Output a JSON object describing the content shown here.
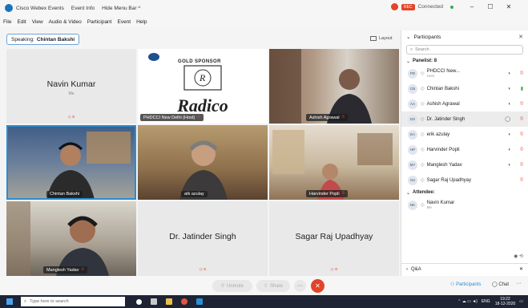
{
  "titlebar": {
    "app_title": "Cisco Webex Events",
    "event_info": "Event Info",
    "hide_menu": "Hide Menu Bar ^",
    "rec_badge": "REC",
    "status": "Connected",
    "minimize": "–",
    "maximize": "☐",
    "close": "✕"
  },
  "menu": [
    "File",
    "Edit",
    "View",
    "Audio & Video",
    "Participant",
    "Event",
    "Help"
  ],
  "speaking": {
    "label": "Speaking:",
    "name": "Chintan Bakshi"
  },
  "layout_label": "Layout",
  "tiles": [
    {
      "name": "Navin Kumar",
      "sub": "Me"
    },
    {
      "label": "PHDCCI New Delhi (Host)",
      "sponsor": "GOLD SPONSOR",
      "brand": "Radico"
    },
    {
      "label": "Ashish Agrawal"
    },
    {
      "label": "Chintan Bakshi"
    },
    {
      "label": "atk azulay"
    },
    {
      "label": "Harvinder Popli"
    },
    {
      "label": "Manglesh Yadav"
    },
    {
      "name": "Dr. Jatinder Singh"
    },
    {
      "name": "Sagar Raj Upadhyay"
    }
  ],
  "sidebar": {
    "title": "Participants",
    "search_placeholder": "Search",
    "panelists_header": "Panelist: 8",
    "attendee_header": "Attendee:",
    "panelists": [
      {
        "initials": "PD",
        "name": "PHDCCI New...",
        "sub": "Host"
      },
      {
        "initials": "CB",
        "name": "Chintan Bakshi"
      },
      {
        "initials": "AA",
        "name": "Ashish Agrawal"
      },
      {
        "initials": "DS",
        "name": "Dr. Jatinder Singh"
      },
      {
        "initials": "EA",
        "name": "erik azulay"
      },
      {
        "initials": "HP",
        "name": "Harvinder Popli"
      },
      {
        "initials": "MY",
        "name": "Manglesh Yadav"
      },
      {
        "initials": "SU",
        "name": "Sagar Raj Upadhyay"
      }
    ],
    "attendees": [
      {
        "initials": "NK",
        "name": "Navin Kumar",
        "sub": "Me"
      }
    ],
    "qa_label": "Q&A"
  },
  "controls": {
    "unmute": "Unmute",
    "share": "Share",
    "participants": "Participants",
    "chat": "Chat"
  },
  "taskbar": {
    "search_placeholder": "Type here to search",
    "lang": "ENG",
    "time": "19:22",
    "date": "18-12-2020"
  }
}
